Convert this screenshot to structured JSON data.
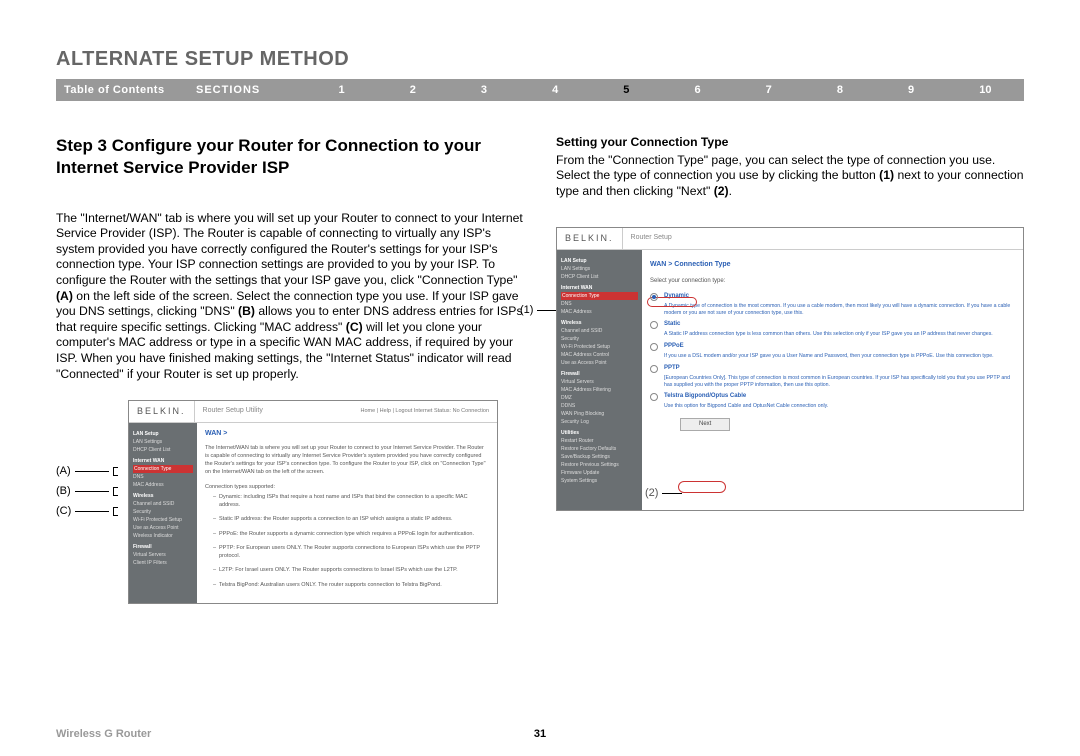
{
  "page": {
    "title": "ALTERNATE SETUP METHOD",
    "step_heading": "Step 3 Configure your Router for Connection to your Internet Service Provider ISP"
  },
  "nav": {
    "toc": "Table of Contents",
    "label": "SECTIONS",
    "items": [
      "1",
      "2",
      "3",
      "4",
      "5",
      "6",
      "7",
      "8",
      "9",
      "10"
    ],
    "active": "5"
  },
  "left": {
    "para": "The \"Internet/WAN\" tab is where you will set up your Router to connect to your Internet Service Provider (ISP). The Router is capable of connecting to virtually any ISP's system provided you have correctly configured the Router's settings for your ISP's connection type. Your ISP connection settings are provided to you by your ISP. To configure the Router with the settings that your ISP gave you, click \"Connection Type\" ",
    "para_a": "(A)",
    "para_mid": " on the left side of the screen. Select the connection type you use. If your ISP gave you DNS settings, clicking \"DNS\" ",
    "para_b": "(B)",
    "para_mid2": " allows you to enter DNS address entries for ISPs that require specific settings. Clicking \"MAC address\" ",
    "para_c": "(C)",
    "para_end": " will let you clone your computer's MAC address or type in a specific WAN MAC address, if required by your ISP. When you have finished making settings, the \"Internet Status\" indicator will read \"Connected\" if your Router is set up properly."
  },
  "right": {
    "subhead": "Setting your Connection Type",
    "para": "From the \"Connection Type\" page, you can select the type of connection you use. Select the type of connection you use by clicking the button ",
    "c1": "(1)",
    "mid": " next to your connection type and then clicking \"Next\" ",
    "c2": "(2)",
    "end": "."
  },
  "shot1": {
    "logo": "BELKIN.",
    "title": "Router Setup Utility",
    "header_right": "Home | Help | Logout  Internet Status: No Connection",
    "crumb": "WAN >",
    "intro": "The Internet/WAN tab is where you will set up your Router to connect to your Internet Service Provider. The Router is capable of connecting to virtually any Internet Service Provider's system provided you have correctly configured the Router's settings for your ISP's connection type. To configure the Router to your ISP, click on \"Connection Type\" on the Internet/WAN tab on the left of the screen.",
    "list_head": "Connection types supported:",
    "items": [
      "Dynamic: including ISPs that require a host name and ISPs that bind the connection to a specific MAC address.",
      "Static IP address: the Router supports a connection to an ISP which assigns a static IP address.",
      "PPPoE: the Router supports a dynamic connection type which requires a PPPoE login for authentication.",
      "PPTP: For European users ONLY. The Router supports connections to European ISPs which use the PPTP protocol.",
      "L2TP: For Israel users ONLY. The Router supports connections to Israel ISPs which use the L2TP.",
      "Telstra BigPond: Australian users ONLY. The router supports connection to Telstra BigPond."
    ],
    "sidebar": {
      "groups": [
        {
          "head": "LAN Setup",
          "items": [
            "LAN Settings",
            "DHCP Client List"
          ]
        },
        {
          "head": "Internet WAN",
          "items": [
            "Connection Type",
            "DNS",
            "MAC Address"
          ]
        },
        {
          "head": "Wireless",
          "items": [
            "Channel and SSID",
            "Security",
            "Wi-Fi Protected Setup",
            "Use as Access Point",
            "Wireless Indicator"
          ]
        },
        {
          "head": "Firewall",
          "items": [
            "Virtual Servers",
            "Client IP Filters"
          ]
        }
      ]
    }
  },
  "shot2": {
    "logo": "BELKIN.",
    "title": "Router Setup",
    "crumb": "WAN > Connection Type",
    "sub": "Select your connection type:",
    "options": [
      {
        "label": "Dynamic",
        "desc": "A Dynamic type of connection is the most common. If you use a cable modem, then most likely you will have a dynamic connection. If you have a cable modem or you are not sure of your connection type, use this.",
        "checked": true
      },
      {
        "label": "Static",
        "desc": "A Static IP address connection type is less common than others. Use this selection only if your ISP gave you an IP address that never changes.",
        "checked": false
      },
      {
        "label": "PPPoE",
        "desc": "If you use a DSL modem and/or your ISP gave you a User Name and Password, then your connection type is PPPoE. Use this connection type.",
        "checked": false
      },
      {
        "label": "PPTP",
        "desc": "[European Countries Only]. This type of connection is most common in European countries. If your ISP has specifically told you that you use PPTP and has supplied you with the proper PPTP information, then use this option.",
        "checked": false
      },
      {
        "label": "Telstra Bigpond/Optus Cable",
        "desc": "Use this option for Bigpond Cable and OptusNet Cable connection only.",
        "checked": false
      }
    ],
    "next": "Next",
    "sidebar": {
      "groups": [
        {
          "head": "LAN Setup",
          "items": [
            "LAN Settings",
            "DHCP Client List"
          ]
        },
        {
          "head": "Internet WAN",
          "items": [
            "Connection Type",
            "DNS",
            "MAC Address"
          ]
        },
        {
          "head": "Wireless",
          "items": [
            "Channel and SSID",
            "Security",
            "Wi-Fi Protected Setup",
            "MAC Address Control",
            "Use as Access Point"
          ]
        },
        {
          "head": "Firewall",
          "items": [
            "Virtual Servers",
            "MAC Address Filtering",
            "DMZ",
            "DDNS",
            "WAN Ping Blocking",
            "Security Log"
          ]
        },
        {
          "head": "Utilities",
          "items": [
            "Restart Router",
            "Restore Factory Defaults",
            "Save/Backup Settings",
            "Restore Previous Settings",
            "Firmware Update",
            "System Settings"
          ]
        }
      ]
    }
  },
  "callouts": {
    "a": "(A)",
    "b": "(B)",
    "c": "(C)",
    "n1": "(1)",
    "n2": "(2)"
  },
  "footer": {
    "left": "Wireless G Router",
    "page": "31"
  }
}
